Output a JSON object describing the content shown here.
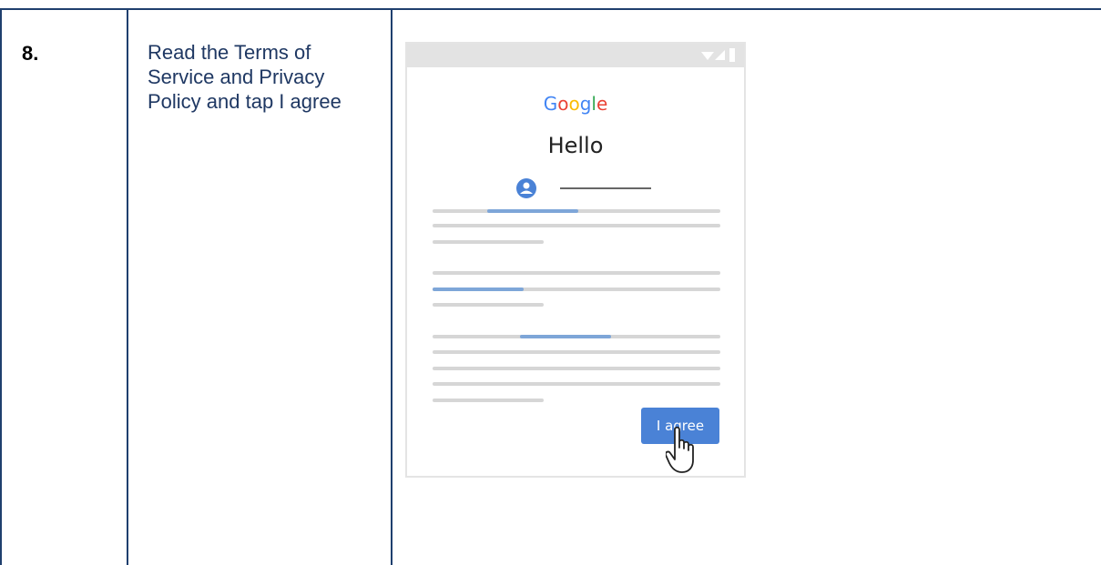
{
  "step": {
    "number": "8.",
    "text": "Read the Terms of Service and Privacy Policy and tap I agree"
  },
  "phone": {
    "brand_letters": [
      {
        "char": "G",
        "color": "#4285f4"
      },
      {
        "char": "o",
        "color": "#ea4335"
      },
      {
        "char": "o",
        "color": "#fbbc05"
      },
      {
        "char": "g",
        "color": "#4285f4"
      },
      {
        "char": "l",
        "color": "#34a853"
      },
      {
        "char": "e",
        "color": "#ea4335"
      }
    ],
    "greeting": "Hello",
    "agree_button": "I agree",
    "icons": [
      "wifi-icon",
      "signal-icon",
      "battery-icon",
      "account-icon",
      "pointer-hand-icon"
    ]
  },
  "colors": {
    "accent": "#4a82d6",
    "highlight": "#7ea6d8",
    "table_border": "#1f3f6e",
    "text": "#1f3863"
  }
}
